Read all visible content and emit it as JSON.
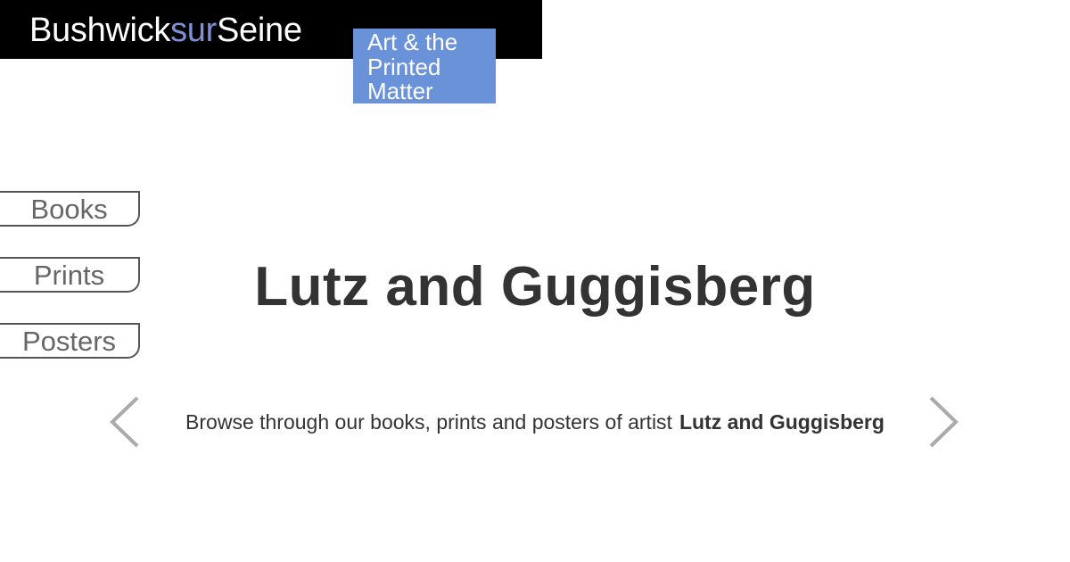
{
  "brand": {
    "name_part1": "Bushwick",
    "name_accent": "sur",
    "name_part2": "Seine",
    "tagline": "Art & the Printed Matter"
  },
  "nav": {
    "items": [
      {
        "label": "Books"
      },
      {
        "label": "Prints"
      },
      {
        "label": "Posters"
      }
    ]
  },
  "main": {
    "title": "Lutz and Guggisberg",
    "browse_text": "Browse through our books, prints and posters of artist",
    "browse_artist": "Lutz and Guggisberg"
  },
  "icons": {
    "prev": "chevron-left-icon",
    "next": "chevron-right-icon"
  },
  "colors": {
    "header_bg": "#000000",
    "brand_accent": "#7f8fd2",
    "tagline_bg": "#6a92d8",
    "title_text": "#333333",
    "tab_text": "#666666",
    "arrow": "#aaaaaa"
  }
}
